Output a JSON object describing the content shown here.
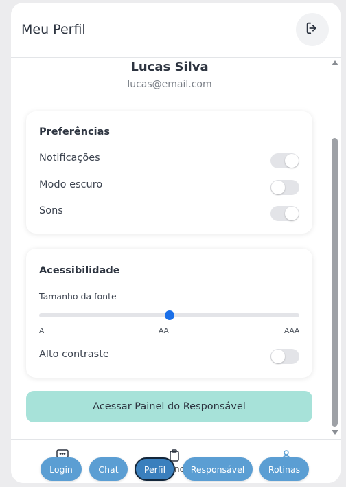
{
  "header": {
    "title": "Meu Perfil",
    "logout_icon": "logout-icon"
  },
  "profile": {
    "name": "Lucas Silva",
    "email": "lucas@email.com"
  },
  "preferences": {
    "title": "Preferências",
    "items": [
      {
        "label": "Notificações",
        "on": true
      },
      {
        "label": "Modo escuro",
        "on": false
      },
      {
        "label": "Sons",
        "on": true
      }
    ]
  },
  "accessibility": {
    "title": "Acessibilidade",
    "font_size_label": "Tamanho da fonte",
    "font_size_value": 0.5,
    "ticks": [
      "A",
      "AA",
      "AAA"
    ],
    "high_contrast_label": "Alto contraste",
    "high_contrast_on": false
  },
  "panel_button": "Acessar Painel do Responsável",
  "bottom_nav": {
    "icons": [
      "chat-icon",
      "clipboard-icon",
      "user-icon"
    ],
    "partial_text": "nc",
    "items": [
      {
        "label": "Login",
        "active": false
      },
      {
        "label": "Chat",
        "active": false
      },
      {
        "label": "Perfil",
        "active": true
      },
      {
        "label": "Responsável",
        "active": false
      },
      {
        "label": "Rotinas",
        "active": false
      }
    ]
  },
  "colors": {
    "accent": "#1a6fe8",
    "panel_button_bg": "#a7e2d9",
    "nav_pill": "#5b9ed3",
    "nav_pill_active": "#3a7fbd"
  }
}
